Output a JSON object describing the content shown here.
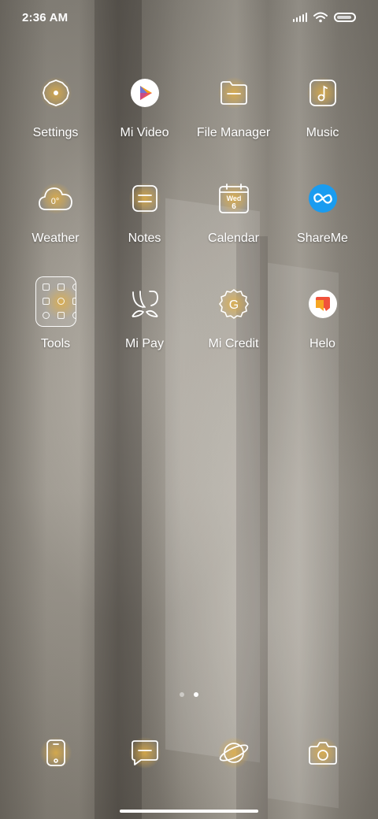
{
  "status_bar": {
    "time": "2:36 AM",
    "icons": [
      "signal-icon",
      "wifi-icon",
      "battery-icon"
    ]
  },
  "apps": [
    {
      "label": "Settings",
      "icon": "settings-icon"
    },
    {
      "label": "Mi Video",
      "icon": "mi-video-icon"
    },
    {
      "label": "File Manager",
      "icon": "file-manager-icon"
    },
    {
      "label": "Music",
      "icon": "music-icon"
    },
    {
      "label": "Weather",
      "icon": "weather-icon",
      "badge": "0°"
    },
    {
      "label": "Notes",
      "icon": "notes-icon"
    },
    {
      "label": "Calendar",
      "icon": "calendar-icon",
      "day": "Wed",
      "date": "6"
    },
    {
      "label": "ShareMe",
      "icon": "shareme-icon"
    },
    {
      "label": "Tools",
      "icon": "tools-folder-icon"
    },
    {
      "label": "Mi Pay",
      "icon": "mi-pay-icon"
    },
    {
      "label": "Mi Credit",
      "icon": "mi-credit-icon",
      "glyph": "G"
    },
    {
      "label": "Helo",
      "icon": "helo-icon"
    }
  ],
  "page_indicator": {
    "pages": 2,
    "current": 2
  },
  "dock": [
    {
      "icon": "phone-icon"
    },
    {
      "icon": "messages-icon"
    },
    {
      "icon": "browser-icon"
    },
    {
      "icon": "camera-icon"
    }
  ],
  "colors": {
    "accent_gold": "#e1af46",
    "mi_video_orange": "#f7a21b",
    "shareme_blue": "#1a9cf0",
    "helo_red": "#f0523b"
  }
}
